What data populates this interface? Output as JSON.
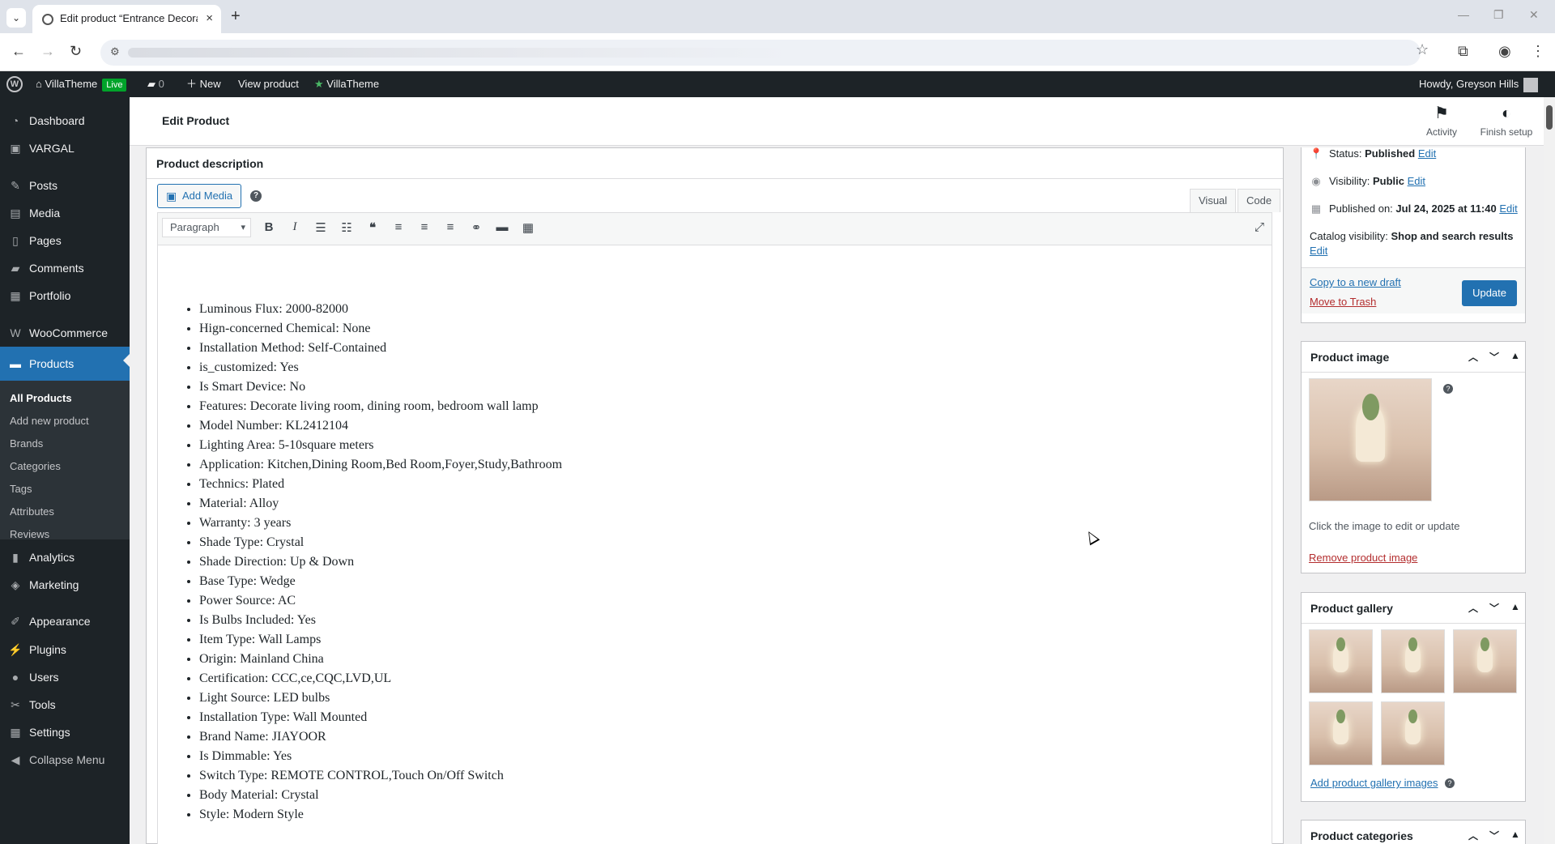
{
  "browser": {
    "tab_title": "Edit product “Entrance Decorat",
    "tab_close": "×",
    "new_tab": "+",
    "back": "←",
    "forward": "→",
    "reload": "↻"
  },
  "adminbar": {
    "site_name": "VillaTheme",
    "live_badge": "Live",
    "comments_count": "0",
    "new_label": "New",
    "view_product": "View product",
    "villatheme_label": "VillaTheme",
    "howdy": "Howdy, Greyson Hills"
  },
  "sidebar": {
    "items": [
      {
        "label": "Dashboard",
        "icon": "dashboard-icon"
      },
      {
        "label": "VARGAL",
        "icon": "vargal-icon"
      },
      {
        "label": "Posts",
        "icon": "pin-icon"
      },
      {
        "label": "Media",
        "icon": "media-icon"
      },
      {
        "label": "Pages",
        "icon": "pages-icon"
      },
      {
        "label": "Comments",
        "icon": "comments-icon"
      },
      {
        "label": "Portfolio",
        "icon": "portfolio-icon"
      },
      {
        "label": "WooCommerce",
        "icon": "woocommerce-icon"
      },
      {
        "label": "Products",
        "icon": "products-icon"
      },
      {
        "label": "Analytics",
        "icon": "analytics-icon"
      },
      {
        "label": "Marketing",
        "icon": "marketing-icon"
      },
      {
        "label": "Appearance",
        "icon": "appearance-icon"
      },
      {
        "label": "Plugins",
        "icon": "plugins-icon"
      },
      {
        "label": "Users",
        "icon": "users-icon"
      },
      {
        "label": "Tools",
        "icon": "tools-icon"
      },
      {
        "label": "Settings",
        "icon": "settings-icon"
      },
      {
        "label": "Collapse Menu",
        "icon": "collapse-icon"
      }
    ],
    "submenu": [
      "All Products",
      "Add new product",
      "Brands",
      "Categories",
      "Tags",
      "Attributes",
      "Reviews"
    ]
  },
  "header": {
    "title": "Edit Product",
    "activity": "Activity",
    "finish_setup": "Finish setup"
  },
  "editor": {
    "section_title": "Product description",
    "add_media": "Add Media",
    "help": "?",
    "tab_visual": "Visual",
    "tab_code": "Code",
    "format_select": "Paragraph",
    "bullets": [
      "Luminous Flux: 2000-82000",
      "Hign-concerned Chemical: None",
      "Installation Method: Self-Contained",
      "is_customized: Yes",
      "Is Smart Device: No",
      "Features: Decorate living room, dining room, bedroom wall lamp",
      "Model Number: KL2412104",
      "Lighting Area: 5-10square meters",
      "Application: Kitchen,Dining Room,Bed Room,Foyer,Study,Bathroom",
      "Technics: Plated",
      "Material: Alloy",
      "Warranty: 3 years",
      "Shade Type: Crystal",
      "Shade Direction: Up & Down",
      "Base Type: Wedge",
      "Power Source: AC",
      "Is Bulbs Included: Yes",
      "Item Type: Wall Lamps",
      "Origin: Mainland China",
      "Certification: CCC,ce,CQC,LVD,UL",
      "Light Source: LED bulbs",
      "Installation Type: Wall Mounted",
      "Brand Name: JIAYOOR",
      "Is Dimmable: Yes",
      "Switch Type: REMOTE CONTROL,Touch On/Off Switch",
      "Body Material: Crystal",
      "Style: Modern Style"
    ]
  },
  "publish": {
    "status_label": "Status:",
    "status_value": "Published",
    "visibility_label": "Visibility:",
    "visibility_value": "Public",
    "published_label": "Published on:",
    "published_value": "Jul 24, 2025 at 11:40",
    "catalog_label": "Catalog visibility:",
    "catalog_value": "Shop and search results",
    "edit": "Edit",
    "copy_draft": "Copy to a new draft",
    "move_trash": "Move to Trash",
    "update": "Update"
  },
  "product_image": {
    "title": "Product image",
    "hint": "Click the image to edit or update",
    "remove": "Remove product image"
  },
  "product_gallery": {
    "title": "Product gallery",
    "add": "Add product gallery images"
  },
  "product_categories": {
    "title": "Product categories"
  }
}
